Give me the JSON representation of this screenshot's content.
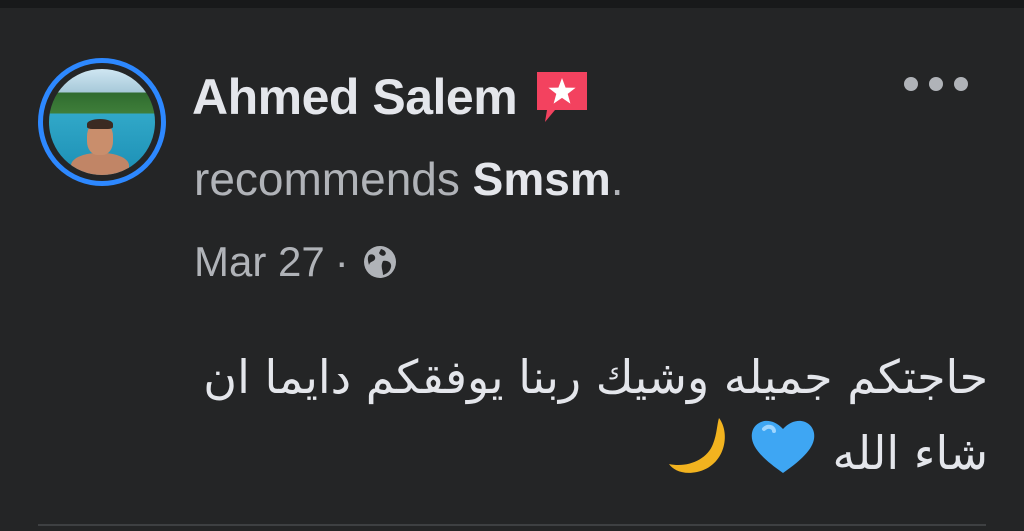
{
  "post": {
    "author": {
      "name": "Ahmed Salem"
    },
    "action_text": "recommends",
    "page_name": "Smsm",
    "punctuation": ".",
    "timestamp": "Mar 27",
    "separator": "·",
    "privacy": "globe-icon",
    "body_line1": "حاجتكم جميله وشيك ربنا يوفقكم دايما ان",
    "body_line2": "شاء الله",
    "emojis": [
      "blue-heart-icon",
      "crescent-moon-icon"
    ]
  },
  "colors": {
    "background": "#242526",
    "accent_ring": "#2d88ff",
    "badge": "#f3425f",
    "primary_text": "#e4e6eb",
    "secondary_text": "#b0b3b8"
  }
}
